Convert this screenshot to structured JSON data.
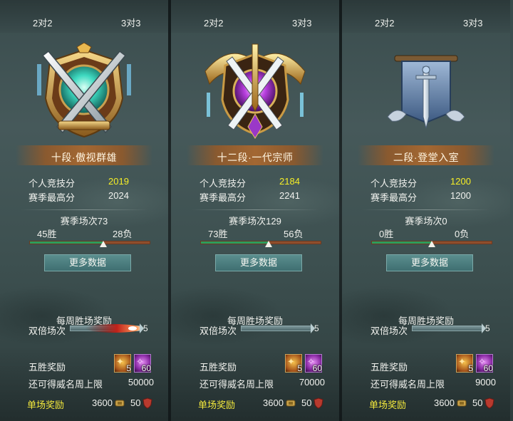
{
  "panels": [
    {
      "tabs": {
        "left": "2对2",
        "right": "3对3"
      },
      "emblem": "crossed-swords-jade-orb-emblem",
      "rank": "十段·傲视群雄",
      "personal_score_label": "个人竞技分",
      "personal_score": "2019",
      "season_high_label": "赛季最高分",
      "season_high": "2024",
      "season_matches": "赛季场次73",
      "wins": "45胜",
      "losses": "28负",
      "win_ratio": 0.616,
      "more_data": "更多数据",
      "weekly_reward_title": "每周胜场奖励",
      "double_label": "双倍场次",
      "double_count": "5",
      "double_bar_glowing": true,
      "five_win_label": "五胜奖励",
      "five_win_items": [
        {
          "icon": "gold-token-icon",
          "count": "5"
        },
        {
          "icon": "purple-crystal-icon",
          "count": "60"
        }
      ],
      "fame_limit_label": "还可得威名周上限",
      "fame_limit": "50000",
      "single_reward_label": "单场奖励",
      "coins": "3600",
      "badges": "50"
    },
    {
      "tabs": {
        "left": "2对2",
        "right": "3对3"
      },
      "emblem": "winged-purple-crystal-emblem",
      "rank": "十二段·一代宗师",
      "personal_score_label": "个人竞技分",
      "personal_score": "2184",
      "season_high_label": "赛季最高分",
      "season_high": "2241",
      "season_matches": "赛季场次129",
      "wins": "73胜",
      "losses": "56负",
      "win_ratio": 0.566,
      "more_data": "更多数据",
      "weekly_reward_title": "每周胜场奖励",
      "double_label": "双倍场次",
      "double_count": "5",
      "double_bar_glowing": false,
      "five_win_label": "五胜奖励",
      "five_win_items": [
        {
          "icon": "gold-token-icon",
          "count": "5"
        },
        {
          "icon": "purple-crystal-icon",
          "count": "60"
        }
      ],
      "fame_limit_label": "还可得威名周上限",
      "fame_limit": "70000",
      "single_reward_label": "单场奖励",
      "coins": "3600",
      "badges": "50"
    },
    {
      "tabs": {
        "left": "2对2",
        "right": "3对3"
      },
      "emblem": "sword-banner-emblem",
      "rank": "二段·登堂入室",
      "personal_score_label": "个人竞技分",
      "personal_score": "1200",
      "season_high_label": "赛季最高分",
      "season_high": "1200",
      "season_matches": "赛季场次0",
      "wins": "0胜",
      "losses": "0负",
      "win_ratio": 0.5,
      "more_data": "更多数据",
      "weekly_reward_title": "每周胜场奖励",
      "double_label": "双倍场次",
      "double_count": "5",
      "double_bar_glowing": false,
      "five_win_label": "五胜奖励",
      "five_win_items": [
        {
          "icon": "gold-token-icon",
          "count": "5"
        },
        {
          "icon": "purple-crystal-icon",
          "count": "60"
        }
      ],
      "fame_limit_label": "还可得威名周上限",
      "fame_limit": "9000",
      "single_reward_label": "单场奖励",
      "coins": "3600",
      "badges": "50"
    }
  ],
  "colors": {
    "score_highlight": "#f6ee26",
    "single_reward": "#f3e93c",
    "win_bar": "#2c9c5c",
    "loss_bar": "#8f4e2c",
    "button": "#4a7e7f"
  }
}
